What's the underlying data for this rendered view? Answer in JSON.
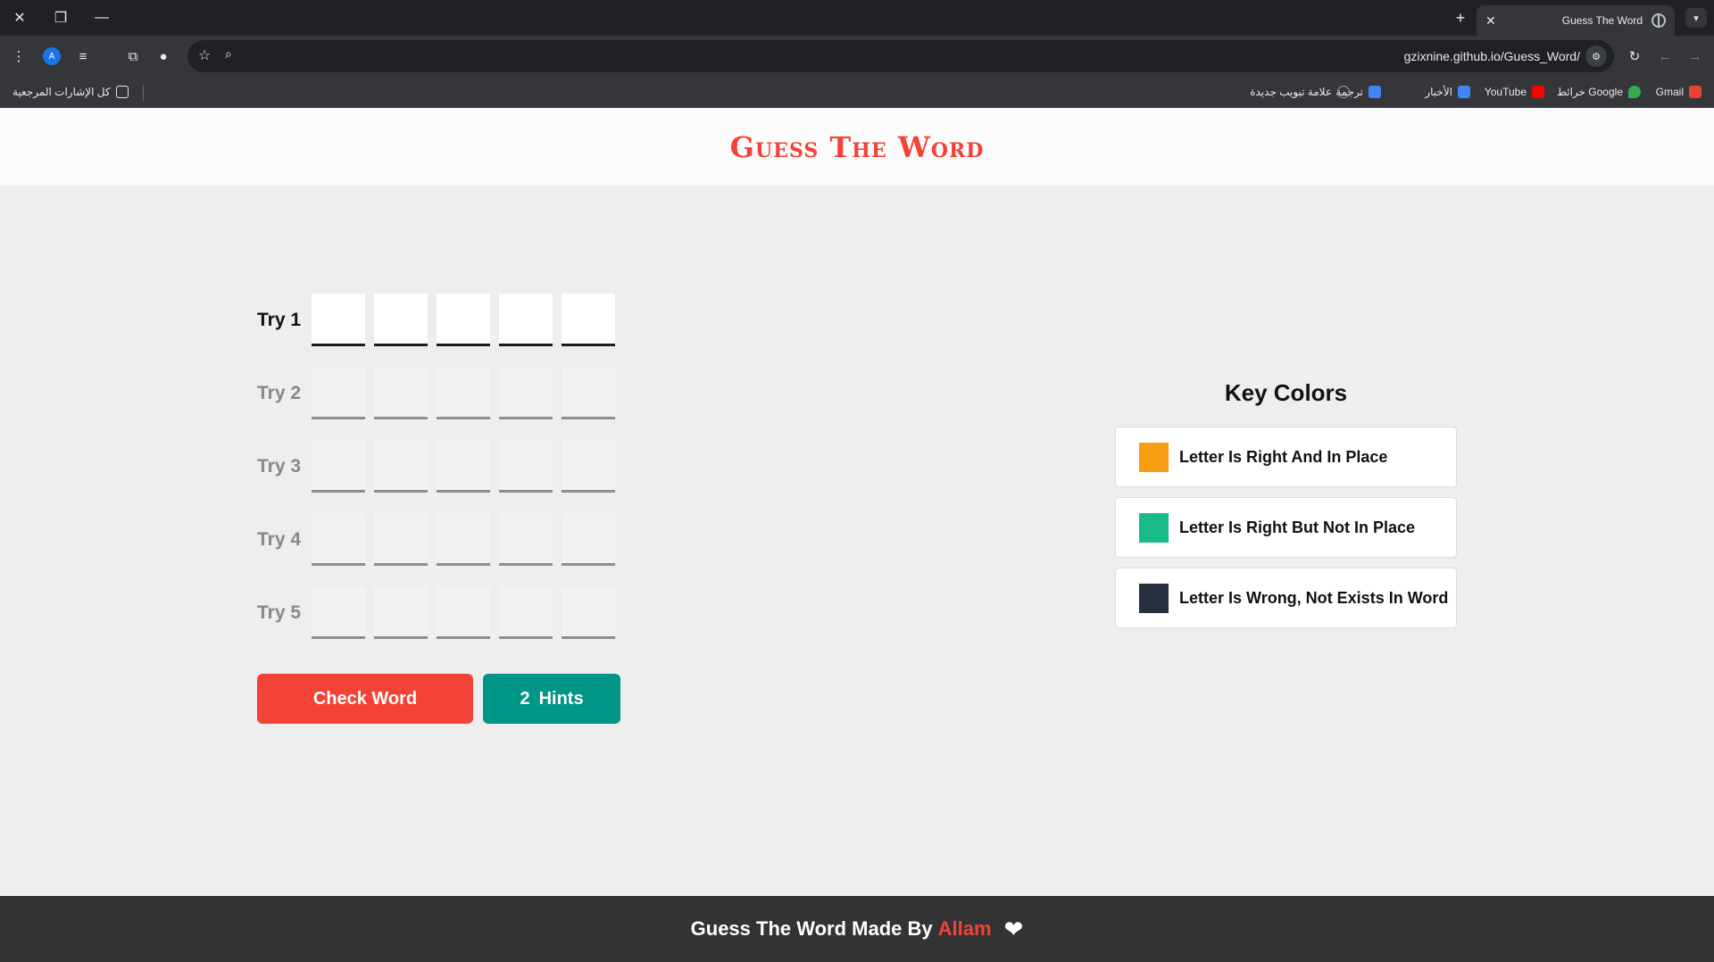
{
  "browser": {
    "tab_title": "Guess The Word",
    "url": "gzixnine.github.io/Guess_Word/",
    "profile_initial": "A",
    "bookmarks": [
      {
        "label": "Gmail",
        "color": "#ea4335"
      },
      {
        "label": "خرائط Google",
        "color": "#34a853"
      },
      {
        "label": "YouTube",
        "color": "#ff0000"
      },
      {
        "label": "الأخبار",
        "color": "#4285f4"
      },
      {
        "label": "ترجمة",
        "color": "#4285f4"
      },
      {
        "label": "علامة تبويب جديدة",
        "color": "#9aa0a6"
      }
    ],
    "all_bookmarks_label": "كل الإشارات المرجعية"
  },
  "header": {
    "title": "Guess The Word"
  },
  "tries": {
    "labels": [
      "Try 1",
      "Try 2",
      "Try 3",
      "Try 4",
      "Try 5"
    ],
    "letters_per_try": 5,
    "active_try": 1
  },
  "actions": {
    "check_label": "Check Word",
    "hints_count": "2",
    "hints_label": "Hints"
  },
  "key_colors": {
    "title": "Key Colors",
    "items": [
      {
        "text": "Letter Is Right And In Place",
        "color": "#f89e13"
      },
      {
        "text": "Letter Is Right But Not In Place",
        "color": "#18ba89"
      },
      {
        "text": "Letter Is Wrong, Not Exists In Word",
        "color": "#27303f"
      }
    ]
  },
  "footer": {
    "prefix": "Guess The Word Made By",
    "author": "Allam",
    "heart": "❤"
  }
}
